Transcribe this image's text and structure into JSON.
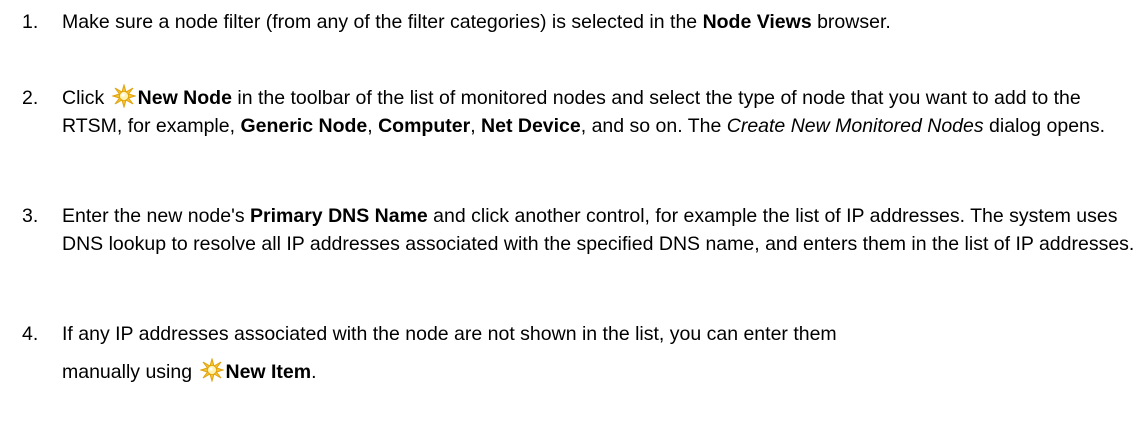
{
  "steps": [
    {
      "number": "1.",
      "parts": {
        "a": "Make sure a node filter (from any of the filter categories) is selected in the ",
        "b": "Node Views",
        "c": " browser."
      }
    },
    {
      "number": "2.",
      "icon": "new-sparkle-icon",
      "parts": {
        "a": "Click ",
        "b": "New Node",
        "c": " in the toolbar of the list of monitored nodes and select the type of node that you want to add to the RTSM, for example, ",
        "d": "Generic Node",
        "e": ", ",
        "f": "Computer",
        "g": ", ",
        "h": "Net Device",
        "i": ", and so on. The ",
        "j": "Create New Monitored Nodes",
        "k": " dialog opens."
      }
    },
    {
      "number": "3.",
      "parts": {
        "a": "Enter the new node's ",
        "b": "Primary DNS Name",
        "c": " and click another control, for example the list of IP addresses. The system uses DNS lookup to resolve all IP addresses associated with the specified DNS name, and enters them in the list of IP addresses."
      }
    },
    {
      "number": "4.",
      "icon": "new-sparkle-icon",
      "parts": {
        "a": "If any IP addresses associated with the node are not shown in the list, you can enter them",
        "b": "manually using ",
        "c": "New Item",
        "d": "."
      }
    }
  ],
  "colors": {
    "text": "#000000",
    "icon_fill": "#f5c431",
    "icon_core": "#ffe680"
  }
}
